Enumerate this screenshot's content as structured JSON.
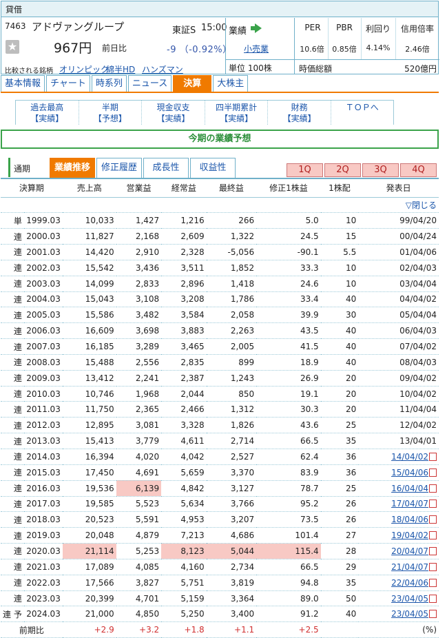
{
  "header": {
    "category": "貸借",
    "code": "7463",
    "name": "アドヴァングループ",
    "market": "東証S",
    "time": "15:00",
    "price": "967円",
    "prev_label": "前日比",
    "change": "-9 （-0.92%）",
    "compare_label": "比較される銘柄",
    "compare": [
      "オリンピック",
      "綿半HD",
      "ハンズマン"
    ],
    "gyoseki_label": "業績",
    "sector": "小売業",
    "unit": "単位 100株",
    "metrics": [
      {
        "label": "PER",
        "value": "10.6倍"
      },
      {
        "label": "PBR",
        "value": "0.85倍"
      },
      {
        "label": "利回り",
        "value": "4.14%"
      },
      {
        "label": "信用倍率",
        "value": "2.46倍"
      }
    ],
    "market_cap_label": "時価総額",
    "market_cap": "520億円"
  },
  "tabs": [
    "基本情報",
    "チャート",
    "時系列",
    "ニュース",
    "決算",
    "大株主"
  ],
  "active_tab": 4,
  "submenu": [
    {
      "l1": "過去最高",
      "l2": "【実績】"
    },
    {
      "l1": "半期",
      "l2": "【予想】"
    },
    {
      "l1": "現金収支",
      "l2": "【実績】"
    },
    {
      "l1": "四半期累計",
      "l2": "【実績】"
    },
    {
      "l1": "財務",
      "l2": "【実績】"
    },
    {
      "l1": "ＴＯＰへ",
      "l2": ""
    }
  ],
  "banner": "今期の業績予想",
  "table_tabs": {
    "period": "通期",
    "tabs": [
      "業績推移",
      "修正履歴",
      "成長性",
      "収益性"
    ],
    "quarters": [
      "1Q",
      "2Q",
      "3Q",
      "4Q"
    ]
  },
  "table": {
    "headers": [
      "決算期",
      "売上高",
      "営業益",
      "経常益",
      "最終益",
      "修正1株益",
      "1株配",
      "発表日"
    ],
    "toggle": "▽閉じる",
    "rows": [
      [
        "単",
        "1999.03",
        "10,033",
        "1,427",
        "1,216",
        "266",
        "5.0",
        "10",
        "99/04/20"
      ],
      [
        "連",
        "2000.03",
        "11,827",
        "2,168",
        "2,609",
        "1,322",
        "24.5",
        "15",
        "00/04/24"
      ],
      [
        "連",
        "2001.03",
        "14,420",
        "2,910",
        "2,328",
        "-5,056",
        "-90.1",
        "5.5",
        "01/04/06"
      ],
      [
        "連",
        "2002.03",
        "15,542",
        "3,436",
        "3,511",
        "1,852",
        "33.3",
        "10",
        "02/04/03"
      ],
      [
        "連",
        "2003.03",
        "14,099",
        "2,833",
        "2,896",
        "1,418",
        "24.6",
        "10",
        "03/04/04"
      ],
      [
        "連",
        "2004.03",
        "15,043",
        "3,108",
        "3,208",
        "1,786",
        "33.4",
        "40",
        "04/04/02"
      ],
      [
        "連",
        "2005.03",
        "15,586",
        "3,482",
        "3,584",
        "2,058",
        "39.9",
        "30",
        "05/04/04"
      ],
      [
        "連",
        "2006.03",
        "16,609",
        "3,698",
        "3,883",
        "2,263",
        "43.5",
        "40",
        "06/04/03"
      ],
      [
        "連",
        "2007.03",
        "16,185",
        "3,289",
        "3,465",
        "2,005",
        "41.5",
        "40",
        "07/04/02"
      ],
      [
        "連",
        "2008.03",
        "15,488",
        "2,556",
        "2,835",
        "899",
        "18.9",
        "40",
        "08/04/03"
      ],
      [
        "連",
        "2009.03",
        "13,412",
        "2,241",
        "2,387",
        "1,243",
        "26.9",
        "20",
        "09/04/02"
      ],
      [
        "連",
        "2010.03",
        "10,746",
        "1,968",
        "2,044",
        "850",
        "19.1",
        "20",
        "10/04/02"
      ],
      [
        "連",
        "2011.03",
        "11,750",
        "2,365",
        "2,466",
        "1,312",
        "30.3",
        "20",
        "11/04/04"
      ],
      [
        "連",
        "2012.03",
        "12,895",
        "3,081",
        "3,328",
        "1,826",
        "43.6",
        "25",
        "12/04/02"
      ],
      [
        "連",
        "2013.03",
        "15,413",
        "3,779",
        "4,611",
        "2,714",
        "66.5",
        "35",
        "13/04/01"
      ],
      [
        "連",
        "2014.03",
        "16,394",
        "4,020",
        "4,042",
        "2,527",
        "62.4",
        "36",
        "14/04/02"
      ],
      [
        "連",
        "2015.03",
        "17,450",
        "4,691",
        "5,659",
        "3,370",
        "83.9",
        "36",
        "15/04/06"
      ],
      [
        "連",
        "2016.03",
        "19,536",
        "6,139",
        "4,842",
        "3,127",
        "78.7",
        "25",
        "16/04/04"
      ],
      [
        "連",
        "2017.03",
        "19,585",
        "5,523",
        "5,634",
        "3,766",
        "95.2",
        "26",
        "17/04/07"
      ],
      [
        "連",
        "2018.03",
        "20,523",
        "5,591",
        "4,953",
        "3,207",
        "73.5",
        "26",
        "18/04/06"
      ],
      [
        "連",
        "2019.03",
        "20,048",
        "4,879",
        "7,213",
        "4,686",
        "101.4",
        "27",
        "19/04/02"
      ],
      [
        "連",
        "2020.03",
        "21,114",
        "5,253",
        "8,123",
        "5,044",
        "115.4",
        "28",
        "20/04/07"
      ],
      [
        "連",
        "2021.03",
        "17,089",
        "4,085",
        "4,160",
        "2,734",
        "66.5",
        "29",
        "21/04/07"
      ],
      [
        "連",
        "2022.03",
        "17,566",
        "3,827",
        "5,751",
        "3,819",
        "94.8",
        "35",
        "22/04/06"
      ],
      [
        "連",
        "2023.03",
        "20,399",
        "4,701",
        "5,159",
        "3,364",
        "89.0",
        "50",
        "23/04/05"
      ],
      [
        "連 予",
        "2024.03",
        "21,000",
        "4,850",
        "5,250",
        "3,400",
        "91.2",
        "40",
        "23/04/05"
      ]
    ],
    "ratio": {
      "label": "前期比",
      "values": [
        "+2.9",
        "+3.2",
        "+1.8",
        "+1.1",
        "+2.5"
      ],
      "unit": "(%)"
    }
  }
}
